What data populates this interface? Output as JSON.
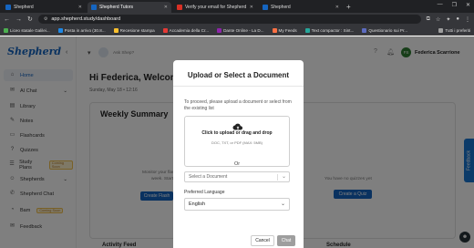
{
  "browser": {
    "tabs": [
      {
        "label": "Shepherd",
        "active": false
      },
      {
        "label": "Shepherd Tutors",
        "active": true
      },
      {
        "label": "Verify your email for Shepherd",
        "active": false
      },
      {
        "label": "Shepherd",
        "active": false
      }
    ],
    "url": "app.shepherd.study/dashboard",
    "bookmarks": [
      "Liceo statale Galilei...",
      "Posta in arrivo (30.8...",
      "Recesione stampa",
      "Accademia della Cr...",
      "Dante Online - La D...",
      "My Feeds",
      "Text compactor : Sint...",
      "Questionario sui Pr..."
    ],
    "bookmarks_right": "Tutti i preferiti"
  },
  "app": {
    "logo": "Shepherd",
    "sidebar": [
      {
        "label": "Home",
        "icon": "home-icon",
        "active": true
      },
      {
        "label": "AI Chat",
        "icon": "chat-icon",
        "chevron": true
      },
      {
        "label": "Library",
        "icon": "library-icon"
      },
      {
        "label": "Notes",
        "icon": "notes-icon"
      },
      {
        "label": "Flashcards",
        "icon": "flashcards-icon"
      },
      {
        "label": "Quizzes",
        "icon": "quizzes-icon"
      },
      {
        "label": "Study Plans",
        "icon": "study-plans-icon",
        "badge": "Coming Soon"
      },
      {
        "label": "Shepherds",
        "icon": "shepherds-icon",
        "chevron": true
      },
      {
        "label": "Shepherd Chat",
        "icon": "shepherd-chat-icon"
      },
      {
        "label": "Bam",
        "icon": "bam-icon",
        "badge": "Coming Soon"
      },
      {
        "label": "Feedback",
        "icon": "feedback-icon"
      }
    ],
    "search_placeholder": "Ask Shep?",
    "user_name": "Federica Scarrione",
    "greeting": "Hi Federica, Welcome",
    "date": "Sunday, May 18 • 12:16",
    "weekly_summary": "Weekly Summary",
    "monitor_text": "Monitor your flashcard pe...",
    "week_text": "week. Start Practic...",
    "create_flash": "Create Flash",
    "no_quizzes": "You have no quizzes yet",
    "create_quiz": "Create a Quiz",
    "activity_feed": "Activity Feed",
    "schedule": "Schedule",
    "feedback_tab": "Feedback"
  },
  "modal": {
    "title": "Upload or Select a Document",
    "description": "To proceed, please upload a document or select from the existing list",
    "dropzone_main": "Click to upload or drag and drop",
    "dropzone_sub": "DOC, TXT, or PDF (MAX: 5MB)",
    "or": "Or",
    "select_placeholder": "Select a Document",
    "language_label": "Preferred Language",
    "language_value": "English",
    "cancel": "Cancel",
    "chat": "Chat"
  }
}
